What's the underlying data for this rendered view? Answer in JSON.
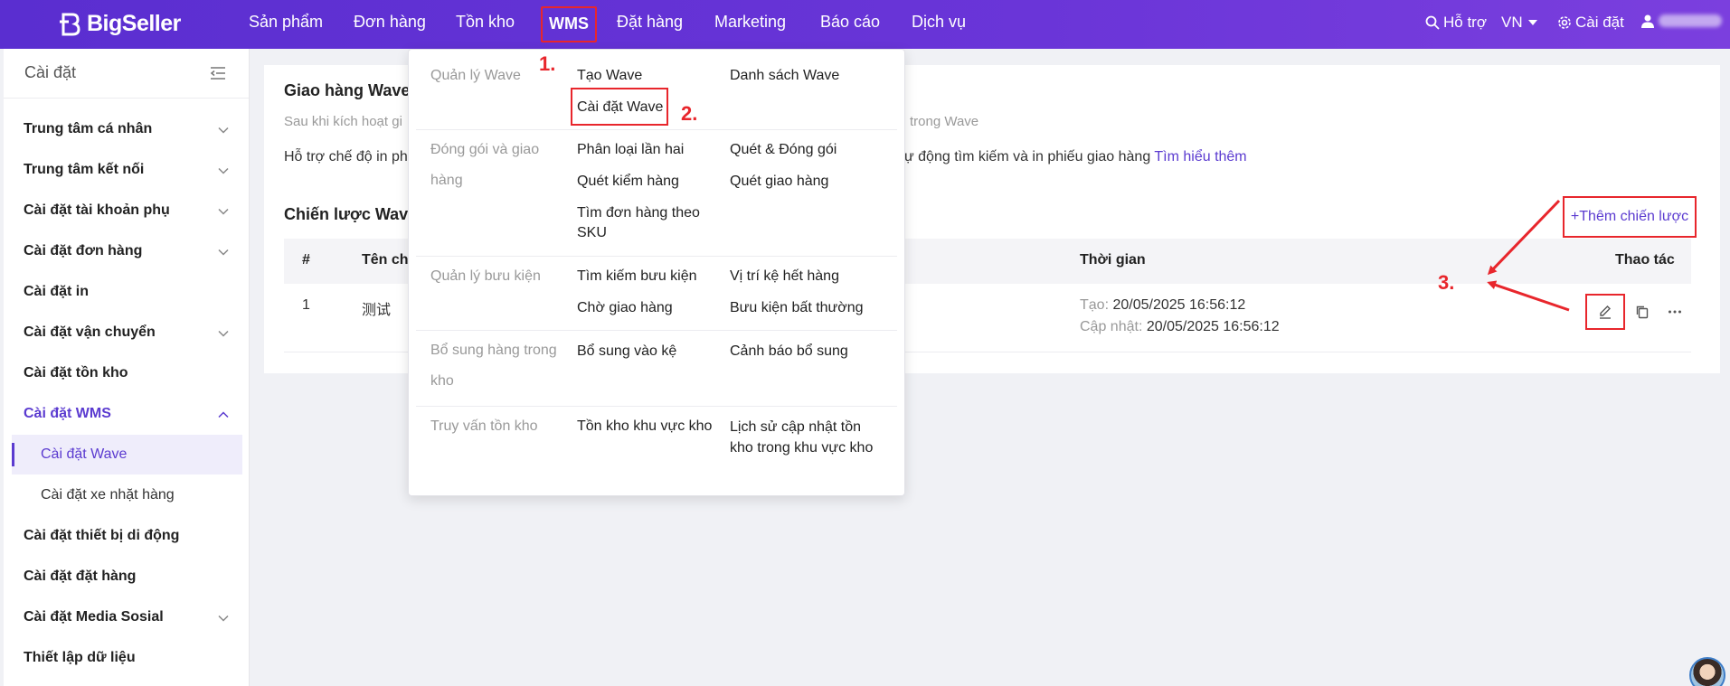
{
  "brand": {
    "name": "BigSeller",
    "accent": "#5b3bd0",
    "topbar_color": "#6232d4",
    "annotation_color": "#e8262c"
  },
  "nav": {
    "items": [
      "Sản phẩm",
      "Đơn hàng",
      "Tồn kho",
      "WMS",
      "Đặt hàng",
      "Marketing",
      "Báo cáo",
      "Dịch vụ"
    ],
    "help": "Hỗ trợ",
    "lang": "VN",
    "settings": "Cài đặt"
  },
  "sidebar": {
    "title": "Cài đặt",
    "items": [
      "Trung tâm cá nhân",
      "Trung tâm kết nối",
      "Cài đặt tài khoản phụ",
      "Cài đặt đơn hàng",
      "Cài đặt in",
      "Cài đặt vận chuyển",
      "Cài đặt tồn kho",
      "Cài đặt WMS",
      "Cài đặt thiết bị di động",
      "Cài đặt đặt hàng",
      "Cài đặt Media Sosial",
      "Thiết lập dữ liệu"
    ],
    "wms_sub": [
      "Cài đặt Wave",
      "Cài đặt xe nhặt hàng"
    ]
  },
  "main": {
    "title": "Giao hàng Wave",
    "desc_left": "Sau khi kích hoạt gi",
    "desc_right": "trong Wave",
    "line2_left": "Hỗ trợ chế độ in phi",
    "line2_right": "ự động tìm kiếm và in phiếu giao hàng ",
    "learn_more": "Tìm hiểu thêm",
    "strategy_title": "Chiến lược Wave",
    "add_strategy": "+Thêm chiến lược",
    "table": {
      "headers": {
        "num": "#",
        "name": "Tên chi",
        "time": "Thời gian",
        "actions": "Thao tác"
      },
      "rows": [
        {
          "num": "1",
          "name": "测试",
          "created_label": "Tạo:",
          "created": "20/05/2025 16:56:12",
          "updated_label": "Cập nhật:",
          "updated": "20/05/2025 16:56:12"
        }
      ]
    }
  },
  "dropdown": {
    "groups": {
      "wave": {
        "label": "Quản lý Wave",
        "links": [
          "Tạo Wave",
          "Cài đặt Wave",
          "Danh sách Wave"
        ]
      },
      "pack": {
        "label": "Đóng gói và giao hàng",
        "links": [
          "Phân loại lần hai",
          "Quét & Đóng gói",
          "Quét kiểm hàng",
          "Quét giao hàng",
          "Tìm đơn hàng theo SKU"
        ]
      },
      "parcel": {
        "label": "Quản lý bưu kiện",
        "links": [
          "Tìm kiếm bưu kiện",
          "Vị trí kệ hết hàng",
          "Chờ giao hàng",
          "Bưu kiện bất thường"
        ]
      },
      "replenish": {
        "label": "Bổ sung hàng trong kho",
        "links": [
          "Bổ sung vào kệ",
          "Cảnh báo bổ sung"
        ]
      },
      "inventory": {
        "label": "Truy vấn tồn kho",
        "links": [
          "Tồn kho khu vực kho",
          "Lịch sử cập nhật tồn kho trong khu vực kho"
        ]
      }
    }
  },
  "annotations": {
    "step1": "1.",
    "step2": "2.",
    "step3": "3."
  }
}
